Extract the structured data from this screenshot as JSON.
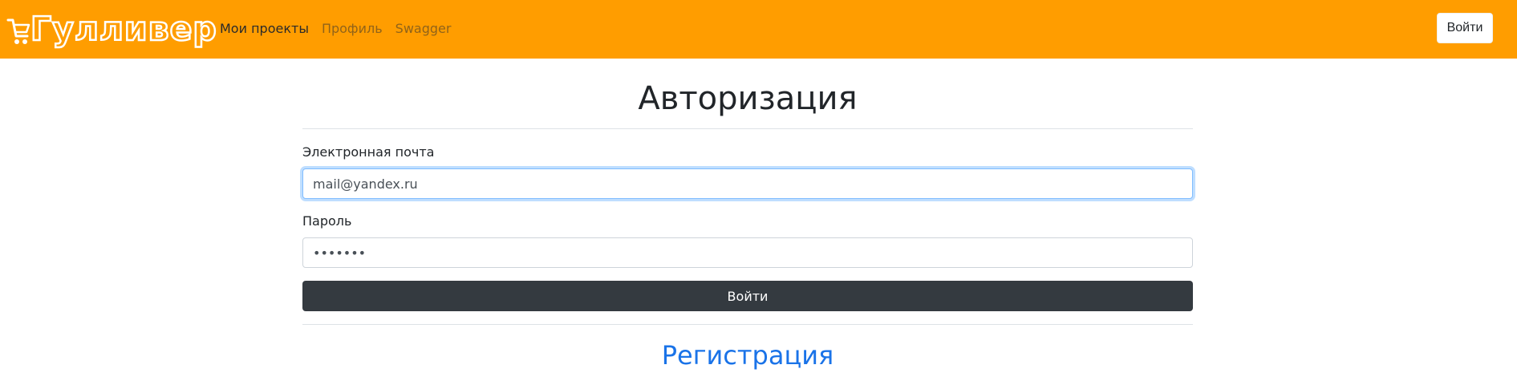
{
  "navbar": {
    "brand_text": "Гулливер",
    "brand_icon": "shopping-cart-icon",
    "links": [
      {
        "label": "Мои проекты",
        "active": true
      },
      {
        "label": "Профиль",
        "active": false
      },
      {
        "label": "Swagger",
        "active": false
      }
    ],
    "login_button": "Войти",
    "background_color": "#ff9d00"
  },
  "page": {
    "title": "Авторизация"
  },
  "form": {
    "email_label": "Электронная почта",
    "email_value": "mail@yandex.ru",
    "password_label": "Пароль",
    "password_value": "•••••••",
    "submit_label": "Войти"
  },
  "footer_link": {
    "register_label": "Регистрация",
    "color": "#1a73e8"
  }
}
